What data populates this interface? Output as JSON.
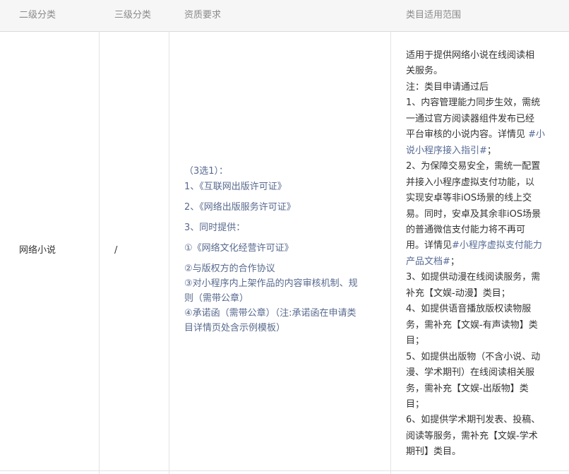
{
  "header": {
    "col1": "二级分类",
    "col2": "三级分类",
    "col3": "资质要求",
    "col4": "类目适用范围"
  },
  "row": {
    "category2": "网络小说",
    "category3": "/",
    "qualifications": [
      "（3选1）：",
      "1、《互联网出版许可证》",
      "2、《网络出版服务许可证》",
      "3、同时提供：",
      "①《网络文化经营许可证》",
      "②与版权方的合作协议",
      "③对小程序内上架作品的内容审核机制、规",
      "则（需带公章）",
      "④承诺函（需带公章）（注:承诺函在申请类",
      "目详情页处含示例模板）"
    ],
    "scope_lines": [
      "适用于提供网络小说在线阅读相",
      "关服务。",
      "注：类目申请通过后",
      "1、内容管理能力同步生效，需统",
      "一通过官方阅读器组件发布已经",
      "平台审核的小说内容。详情见",
      "#小",
      "说小程序接入指引#",
      "；",
      "2、为保障交易安全，需统一配置",
      "并接入小程序虚拟支付功能，以",
      "实现安卓等非iOS场景的线上交",
      "易。同时，安卓及其余非iOS场景",
      "的普通微信支付能力将不再可",
      "用。详情见",
      "#小程序虚拟支付能力",
      "产品文档#",
      "；",
      "3、如提供动漫在线阅读服务，需",
      "补充【文娱-动漫】类目；",
      "4、如提供语音播放版权读物服",
      "务，需补充【文娱-有声读物】类",
      "目；",
      "5、如提供出版物（不含小说、动",
      "漫、学术期刊）在线阅读相关服",
      "务，需补充【文娱-出版物】类",
      "目；",
      "6、如提供学术期刊发表、投稿、",
      "阅读等服务，需补充【文娱-学术",
      "期刊】类目。"
    ]
  },
  "colors": {
    "link": "#576b95",
    "qualification_text": "#586a8e",
    "header_bg": "#f6f6f6",
    "header_text": "#8a8a8a"
  }
}
